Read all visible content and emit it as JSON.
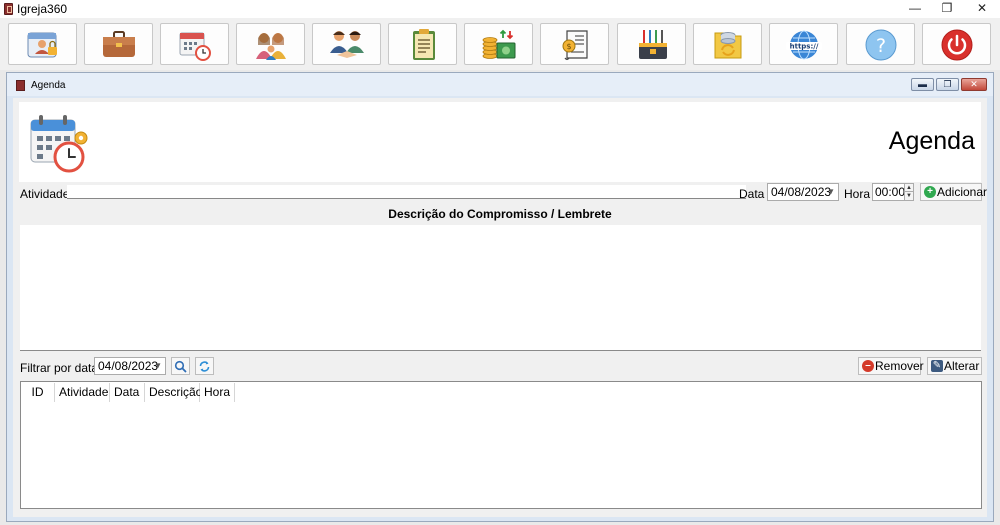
{
  "app": {
    "title": "Igreja360"
  },
  "window_controls": {
    "minimize": "—",
    "maximize": "❐",
    "close": "✕"
  },
  "toolbar": {
    "buttons": [
      {
        "icon": "id-badge-lock-icon"
      },
      {
        "icon": "briefcase-icon"
      },
      {
        "icon": "calendar-clock-icon"
      },
      {
        "icon": "family-icon"
      },
      {
        "icon": "handshake-people-icon"
      },
      {
        "icon": "clipboard-document-icon"
      },
      {
        "icon": "money-coins-icon"
      },
      {
        "icon": "invoice-scroll-icon"
      },
      {
        "icon": "tools-toolbox-icon"
      },
      {
        "icon": "database-sync-icon"
      },
      {
        "icon": "https-globe-icon"
      },
      {
        "icon": "help-question-icon"
      },
      {
        "icon": "power-exit-icon"
      }
    ],
    "https_text": "https://",
    "help_glyph": "?"
  },
  "child_window": {
    "title": "Agenda",
    "controls": {
      "minimize": "▬",
      "restore": "❐",
      "close": "✕"
    }
  },
  "header": {
    "title": "Agenda"
  },
  "form": {
    "atividade_label": "Atividade",
    "atividade_value": "",
    "data_label": "Data",
    "data_value": "04/08/2023",
    "hora_label": "Hora",
    "hora_value": "00:00",
    "adicionar_label": "Adicionar",
    "descricao_heading": "Descrição do Compromisso / Lembrete",
    "descricao_value": ""
  },
  "filter": {
    "label": "Filtrar por data",
    "date_value": "04/08/2023",
    "remover_label": "Remover",
    "alterar_label": "Alterar"
  },
  "grid": {
    "columns": [
      "ID",
      "Atividade",
      "Data",
      "Descrição",
      "Hora"
    ],
    "rows": []
  },
  "colors": {
    "accent_green": "#2fa84f",
    "remove_red": "#d43a2a",
    "power_red": "#d9302c",
    "help_blue": "#8ec5f0"
  }
}
